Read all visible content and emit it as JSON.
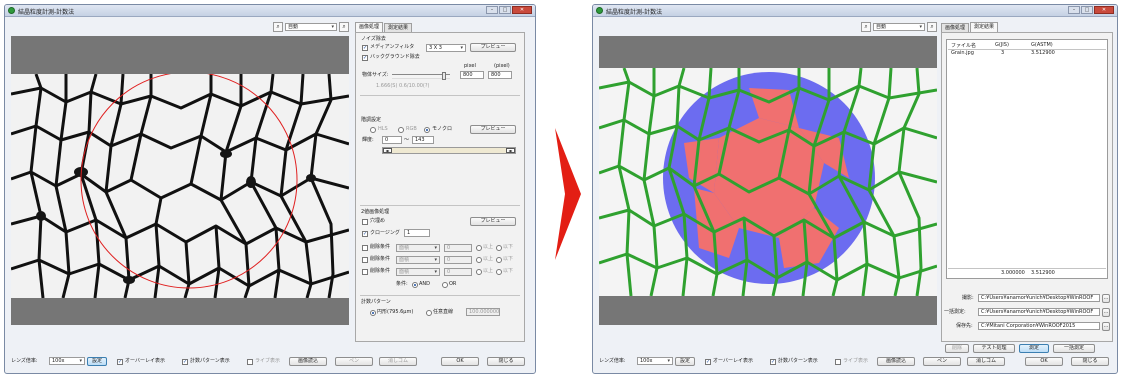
{
  "left_window": {
    "title": "結晶粒度計測-計数法",
    "zoom_value": "自動",
    "tabs": [
      "画像処理",
      "測定結果"
    ],
    "noise": {
      "heading": "ノイズ除去",
      "median_label": "メディアンフィルタ",
      "median_value": "3 X 3",
      "bg_label": "バックグラウンド除去",
      "unit_pixel": "pixel",
      "unit_pixel2": "(pixel)",
      "size_label": "物体サイズ:",
      "size_val1": "800",
      "size_val2": "800",
      "ratio_text": "1.666(S)  0.6/10.00(?)",
      "preview": "プレビュー"
    },
    "threshold": {
      "heading": "階調設定",
      "opt_hls": "HLS",
      "opt_rgb": "RGB",
      "opt_mono": "モノクロ",
      "brightness_label": "輝度:",
      "from": "0",
      "tilde": "～",
      "to": "143",
      "preview": "プレビュー"
    },
    "binary": {
      "heading": "2値画像処理",
      "fill_label": "穴埋め",
      "closing_label": "クロージング",
      "closing_val": "1",
      "preview": "プレビュー",
      "delete_label": "削除条件",
      "area_label": "面積",
      "cond_val": "0",
      "above": "以上",
      "below": "以下",
      "cond_label": "条件:",
      "and": "AND",
      "or": "OR"
    },
    "pattern": {
      "heading": "計数パターン",
      "circle": "円形(795.6μm)",
      "any_line": "任意直線",
      "any_val": "100.000000"
    },
    "status": {
      "lens_label": "レンズ倍率:",
      "lens_value": "100x",
      "set": "設定",
      "overlay": "オーバーレイ表示",
      "pattern_show": "計数パターン表示",
      "live": "ライブ表示",
      "load": "画像読込",
      "pen": "ペン",
      "eraser": "消しゴム",
      "ok": "OK",
      "close": "閉じる"
    }
  },
  "right_window": {
    "title": "結晶粒度計測-計数法",
    "zoom_value": "自動",
    "tabs": [
      "画像処理",
      "測定結果"
    ],
    "table": {
      "headers": [
        "ファイル名",
        "G(JIS)",
        "G(ASTM)"
      ],
      "rows": [
        [
          "Grain.jpg",
          "3",
          "3.512900"
        ]
      ],
      "totals": [
        "3.000000",
        "3.512900"
      ]
    },
    "paths": {
      "shot_label": "撮影:",
      "shot_value": "C:¥Users¥anamor¥unich¥Desktop¥WinROOF",
      "batch_label": "一括測定:",
      "batch_value": "C:¥Users¥anamor¥unich¥Desktop¥WinROOF",
      "save_label": "保存先:",
      "save_value": "C:¥Mitani Corporation¥WinROOF2015"
    },
    "buttons": {
      "delete": "削除",
      "test": "テスト処理",
      "measure": "測定",
      "batch": "一括測定"
    },
    "status": {
      "lens_label": "レンズ倍率:",
      "lens_value": "100x",
      "set": "設定",
      "overlay": "オーバーレイ表示",
      "pattern_show": "計数パターン表示",
      "live": "ライブ表示",
      "load": "画像読込",
      "pen": "ペン",
      "eraser": "消しゴム",
      "ok": "OK",
      "close": "閉じる"
    }
  },
  "colors": {
    "arrow": "#e31e14",
    "grain_red": "#f07070",
    "grain_blue": "#6c6cf0",
    "boundary_green": "#2fa12f",
    "circle_guide": "#e02020"
  },
  "icons": [
    "app-icon",
    "zoom-in-icon",
    "zoom-out-icon",
    "minimize-icon",
    "maximize-icon",
    "close-icon",
    "right-arrow-icon"
  ]
}
